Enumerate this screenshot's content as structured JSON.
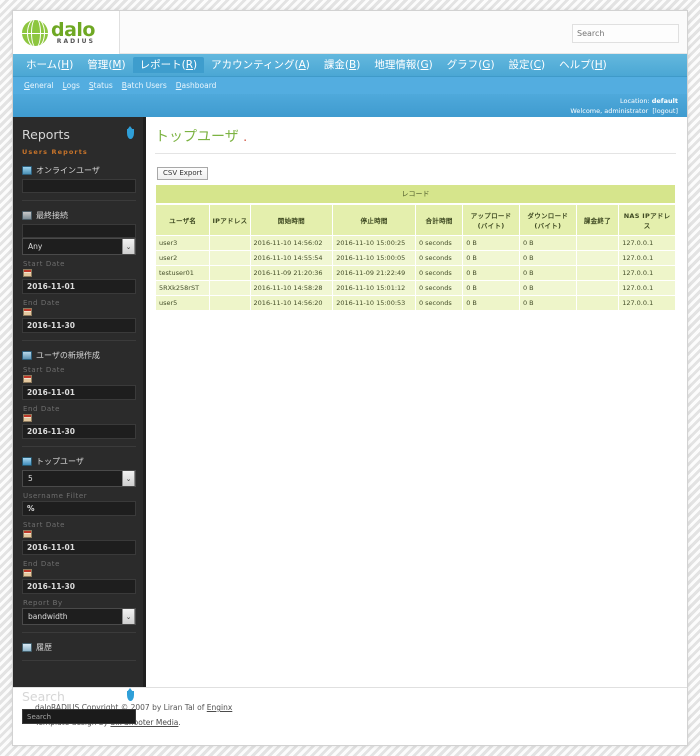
{
  "header": {
    "logo_main": "dalo",
    "logo_sub": "RADIUS",
    "search_placeholder": "Search"
  },
  "mainnav": [
    {
      "label": "ホーム",
      "accesskey": "H",
      "active": false
    },
    {
      "label": "管理",
      "accesskey": "M",
      "active": false
    },
    {
      "label": "レポート",
      "accesskey": "R",
      "active": true
    },
    {
      "label": "アカウンティング",
      "accesskey": "A",
      "active": false
    },
    {
      "label": "課金",
      "accesskey": "B",
      "active": false
    },
    {
      "label": "地理情報",
      "accesskey": "G",
      "active": false
    },
    {
      "label": "グラフ",
      "accesskey": "G",
      "active": false
    },
    {
      "label": "設定",
      "accesskey": "C",
      "active": false
    },
    {
      "label": "ヘルプ",
      "accesskey": "H",
      "active": false
    }
  ],
  "subnav": [
    {
      "label": "General",
      "accesskey": "G"
    },
    {
      "label": "Logs",
      "accesskey": "L"
    },
    {
      "label": "Status",
      "accesskey": "S"
    },
    {
      "label": "Batch Users",
      "accesskey": "B"
    },
    {
      "label": "Dashboard",
      "accesskey": "D"
    }
  ],
  "locationbar": {
    "location_label": "Location:",
    "location_value": "default",
    "welcome": "Welcome, administrator",
    "logout": "[logout]"
  },
  "sidebar": {
    "title": "Reports",
    "subtitle": "Users Reports",
    "online_users": {
      "label": "オンラインユーザ"
    },
    "last_connect": {
      "label": "最終接続",
      "select_value": "Any",
      "start_date_label": "Start Date",
      "start_date_value": "2016-11-01",
      "end_date_label": "End Date",
      "end_date_value": "2016-11-30"
    },
    "new_users": {
      "label": "ユーザの新規作成",
      "start_date_label": "Start Date",
      "start_date_value": "2016-11-01",
      "end_date_label": "End Date",
      "end_date_value": "2016-11-30"
    },
    "top_users": {
      "label": "トップユーザ",
      "limit_value": "5",
      "username_filter_label": "Username Filter",
      "username_filter_value": "%",
      "start_date_label": "Start Date",
      "start_date_value": "2016-11-01",
      "end_date_label": "End Date",
      "end_date_value": "2016-11-30",
      "report_by_label": "Report By",
      "report_by_value": "bandwidth"
    },
    "history": {
      "label": "履歴"
    },
    "search": {
      "title": "Search",
      "placeholder": "Search"
    }
  },
  "content": {
    "page_title": "トップユーザ",
    "page_title_dot": ".",
    "csv_export_label": "CSV Export",
    "table": {
      "caption": "レコード",
      "headers": [
        "ユーザ名",
        "IPアドレス",
        "開始時間",
        "停止時間",
        "合計時間",
        "アップロード (バイト)",
        "ダウンロード (バイト)",
        "課金終了",
        "NAS IPアドレス"
      ],
      "rows": [
        [
          "user3",
          "",
          "2016-11-10 14:56:02",
          "2016-11-10 15:00:25",
          "0 seconds",
          "0 B",
          "0 B",
          "",
          "127.0.0.1"
        ],
        [
          "user2",
          "",
          "2016-11-10 14:55:54",
          "2016-11-10 15:00:05",
          "0 seconds",
          "0 B",
          "0 B",
          "",
          "127.0.0.1"
        ],
        [
          "testuser01",
          "",
          "2016-11-09 21:20:36",
          "2016-11-09 21:22:49",
          "0 seconds",
          "0 B",
          "0 B",
          "",
          "127.0.0.1"
        ],
        [
          "5RXk258rST",
          "",
          "2016-11-10 14:58:28",
          "2016-11-10 15:01:12",
          "0 seconds",
          "0 B",
          "0 B",
          "",
          "127.0.0.1"
        ],
        [
          "user5",
          "",
          "2016-11-10 14:56:20",
          "2016-11-10 15:00:53",
          "0 seconds",
          "0 B",
          "0 B",
          "",
          "127.0.0.1"
        ]
      ]
    }
  },
  "footer": {
    "line1_pre": "daloRADIUS Copyright © 2007 by Liran Tal of ",
    "line1_link": "Enginx",
    "line2_pre": "Template design by ",
    "line2_link": "Six Shooter Media",
    "line2_post": "."
  },
  "colors": {
    "nav_blue": "#4ba7d4",
    "sidebar_dark": "#2b2b2b",
    "title_green": "#7cb342",
    "table_header": "#e4efad",
    "table_caption": "#d6e58c",
    "accent_orange": "#c8742a"
  }
}
